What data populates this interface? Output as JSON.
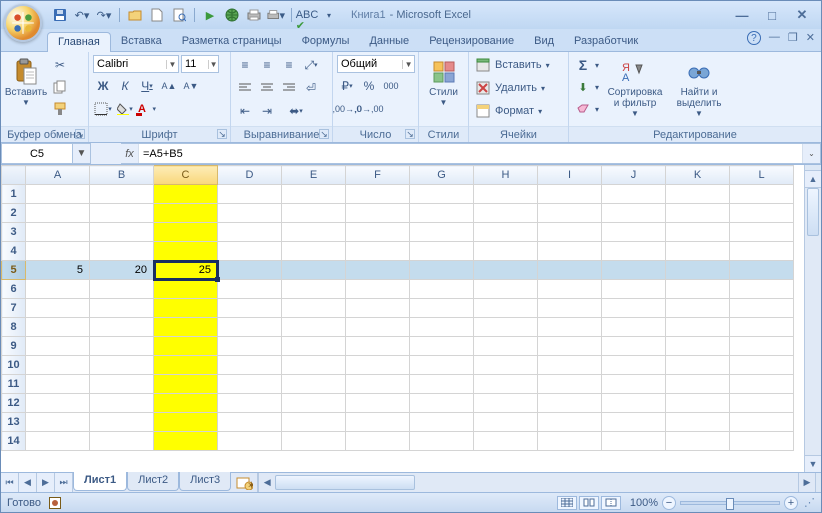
{
  "app": {
    "book": "Книга1",
    "suffix": "- Microsoft Excel"
  },
  "tabs": {
    "home": "Главная",
    "insert": "Вставка",
    "layout": "Разметка страницы",
    "formulas": "Формулы",
    "data": "Данные",
    "review": "Рецензирование",
    "view": "Вид",
    "developer": "Разработчик"
  },
  "groups": {
    "clipboard": {
      "title": "Буфер обмена",
      "paste": "Вставить"
    },
    "font": {
      "title": "Шрифт",
      "name": "Calibri",
      "size": "11"
    },
    "align": {
      "title": "Выравнивание"
    },
    "number": {
      "title": "Число",
      "format": "Общий"
    },
    "styles": {
      "title": "Стили",
      "label": "Стили"
    },
    "cells": {
      "title": "Ячейки",
      "insert": "Вставить",
      "delete": "Удалить",
      "format": "Формат"
    },
    "editing": {
      "title": "Редактирование",
      "sort": "Сортировка и фильтр",
      "find": "Найти и выделить"
    }
  },
  "formula": {
    "cellref": "C5",
    "value": "=A5+B5",
    "fx": "fx"
  },
  "columns": [
    "A",
    "B",
    "C",
    "D",
    "E",
    "F",
    "G",
    "H",
    "I",
    "J",
    "K",
    "L"
  ],
  "cells": {
    "A5": "5",
    "B5": "20",
    "C5": "25"
  },
  "sheets": {
    "s1": "Лист1",
    "s2": "Лист2",
    "s3": "Лист3"
  },
  "status": {
    "ready": "Готово",
    "zoom": "100%"
  }
}
